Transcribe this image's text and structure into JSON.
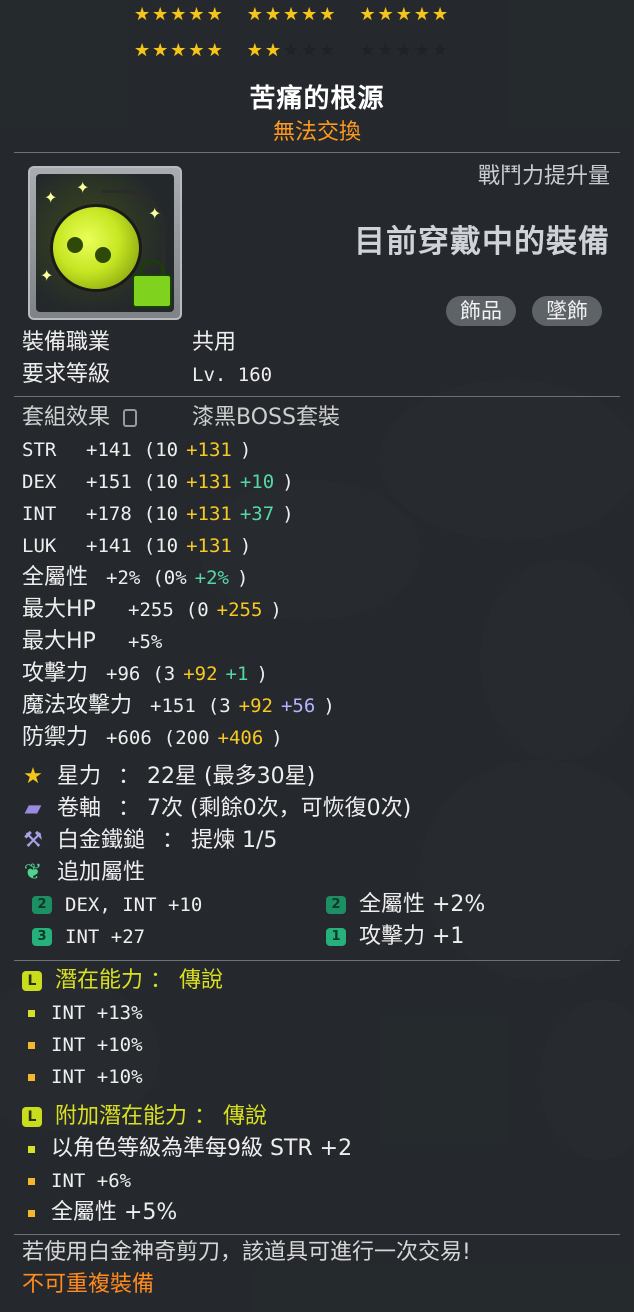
{
  "header": {
    "star_groups": [
      {
        "filled": 5,
        "empty": 0
      },
      {
        "filled": 5,
        "empty": 0
      },
      {
        "filled": 5,
        "empty": 0
      },
      {
        "filled": 5,
        "empty": 0
      },
      {
        "filled": 2,
        "empty": 3
      },
      {
        "filled": 0,
        "empty": 5
      }
    ],
    "star_force_current": 22,
    "star_force_max": 30
  },
  "item": {
    "name": "苦痛的根源",
    "trade_status": "無法交換",
    "icon": "yellow-green-pendant-icon"
  },
  "right_panel": {
    "cp_label": "戰鬥力提升量",
    "equip_now": "目前穿戴中的裝備",
    "tags": [
      "飾品",
      "墜飾"
    ]
  },
  "requirements": {
    "job_label": "裝備職業",
    "job_value": "共用",
    "level_label": "要求等級",
    "level_value": "Lv. 160"
  },
  "set": {
    "label": "套組效果",
    "icon": "lock-icon",
    "value": "漆黑BOSS套裝"
  },
  "stats": [
    {
      "name": "STR",
      "total": "+141",
      "base": "(10",
      "enhance": "+131",
      "flame": "",
      "close": ")",
      "flame_color": "green"
    },
    {
      "name": "DEX",
      "total": "+151",
      "base": "(10",
      "enhance": "+131",
      "flame": "+10",
      "close": ")",
      "flame_color": "green"
    },
    {
      "name": "INT",
      "total": "+178",
      "base": "(10",
      "enhance": "+131",
      "flame": "+37",
      "close": ")",
      "flame_color": "green"
    },
    {
      "name": "LUK",
      "total": "+141",
      "base": "(10",
      "enhance": "+131",
      "flame": "",
      "close": ")",
      "flame_color": "green"
    },
    {
      "name": "全屬性",
      "total": "+2%",
      "base": "(0%",
      "enhance": "",
      "flame": "+2%",
      "close": ")",
      "flame_color": "green"
    },
    {
      "name": "最大HP",
      "total": "+255",
      "base": "(0",
      "enhance": "+255",
      "flame": "",
      "close": ")",
      "flame_color": "green"
    },
    {
      "name": "最大HP",
      "total": "+5%",
      "base": "",
      "enhance": "",
      "flame": "",
      "close": "",
      "flame_color": "green"
    },
    {
      "name": "攻擊力",
      "total": "+96",
      "base": "(3",
      "enhance": "+92",
      "flame": "+1",
      "close": ")",
      "flame_color": "green"
    },
    {
      "name": "魔法攻擊力",
      "total": "+151",
      "base": "(3",
      "enhance": "+92",
      "flame": "+56",
      "close": ")",
      "flame_color": "blue"
    },
    {
      "name": "防禦力",
      "total": "+606",
      "base": "(200",
      "enhance": "+406",
      "flame": "",
      "close": ")",
      "flame_color": "green"
    }
  ],
  "enhancements": {
    "starforce_label": "星力",
    "starforce_value": "：  22星 (最多30星)",
    "scroll_label": "卷軸",
    "scroll_value": "：  7次 (剩餘0次，可恢復0次)",
    "hammer_label": "白金鐵鎚",
    "hammer_value": "：  提煉 1/5",
    "extra_label": "追加屬性"
  },
  "extra_stats": [
    {
      "tier": "2",
      "text": "DEX, INT   +10"
    },
    {
      "tier": "2",
      "text": "全屬性  +2%"
    },
    {
      "tier": "3",
      "text": "INT   +27"
    },
    {
      "tier": "1",
      "text": "攻擊力  +1"
    }
  ],
  "potential": {
    "badge": "L",
    "title": "潛在能力 ： 傳說",
    "lines": [
      "INT +13%",
      "INT +10%",
      "INT +10%"
    ]
  },
  "bonus_potential": {
    "badge": "L",
    "title": "附加潛在能力 ： 傳說",
    "lines": [
      "以角色等級為準每9級 STR +2",
      "INT +6%",
      "全屬性  +5%"
    ]
  },
  "footer": {
    "scissors_note": "若使用白金神奇剪刀，該道具可進行一次交易!",
    "unique_note": "不可重複裝備"
  },
  "colors": {
    "star": "#f3c51d",
    "enhance": "#f8c821",
    "flame_green": "#55d8a2",
    "flame_blue": "#b4b4ff",
    "trade": "#ff9a1e",
    "potential_title": "#d9e020"
  }
}
